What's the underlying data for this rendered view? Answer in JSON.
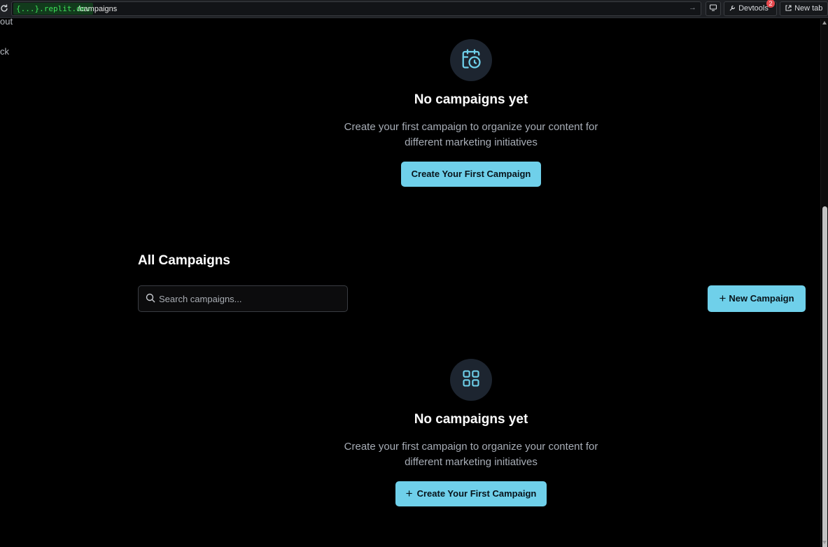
{
  "browser": {
    "domain": "{...}.replit.dev",
    "path": "/campaigns",
    "devtools_label": "Devtools",
    "devtools_badge": "2",
    "newtab_label": "New tab"
  },
  "sidebar_fragments": [
    "out",
    "ck"
  ],
  "empty_top": {
    "icon": "calendar-clock-icon",
    "title": "No campaigns yet",
    "line1": "Create your first campaign to organize your content for",
    "line2": "different marketing initiatives",
    "button": "Create Your First Campaign"
  },
  "campaigns": {
    "title": "All Campaigns",
    "search_placeholder": "Search campaigns...",
    "new_button": "New Campaign"
  },
  "empty_bottom": {
    "icon": "grid-icon",
    "title": "No campaigns yet",
    "line1": "Create your first campaign to organize your content for",
    "line2": "different marketing initiatives",
    "button": "Create Your First Campaign"
  },
  "colors": {
    "accent": "#6fd0ea",
    "background": "#000000",
    "icon_bg": "#1d2530",
    "muted_text": "#a7adb6"
  }
}
